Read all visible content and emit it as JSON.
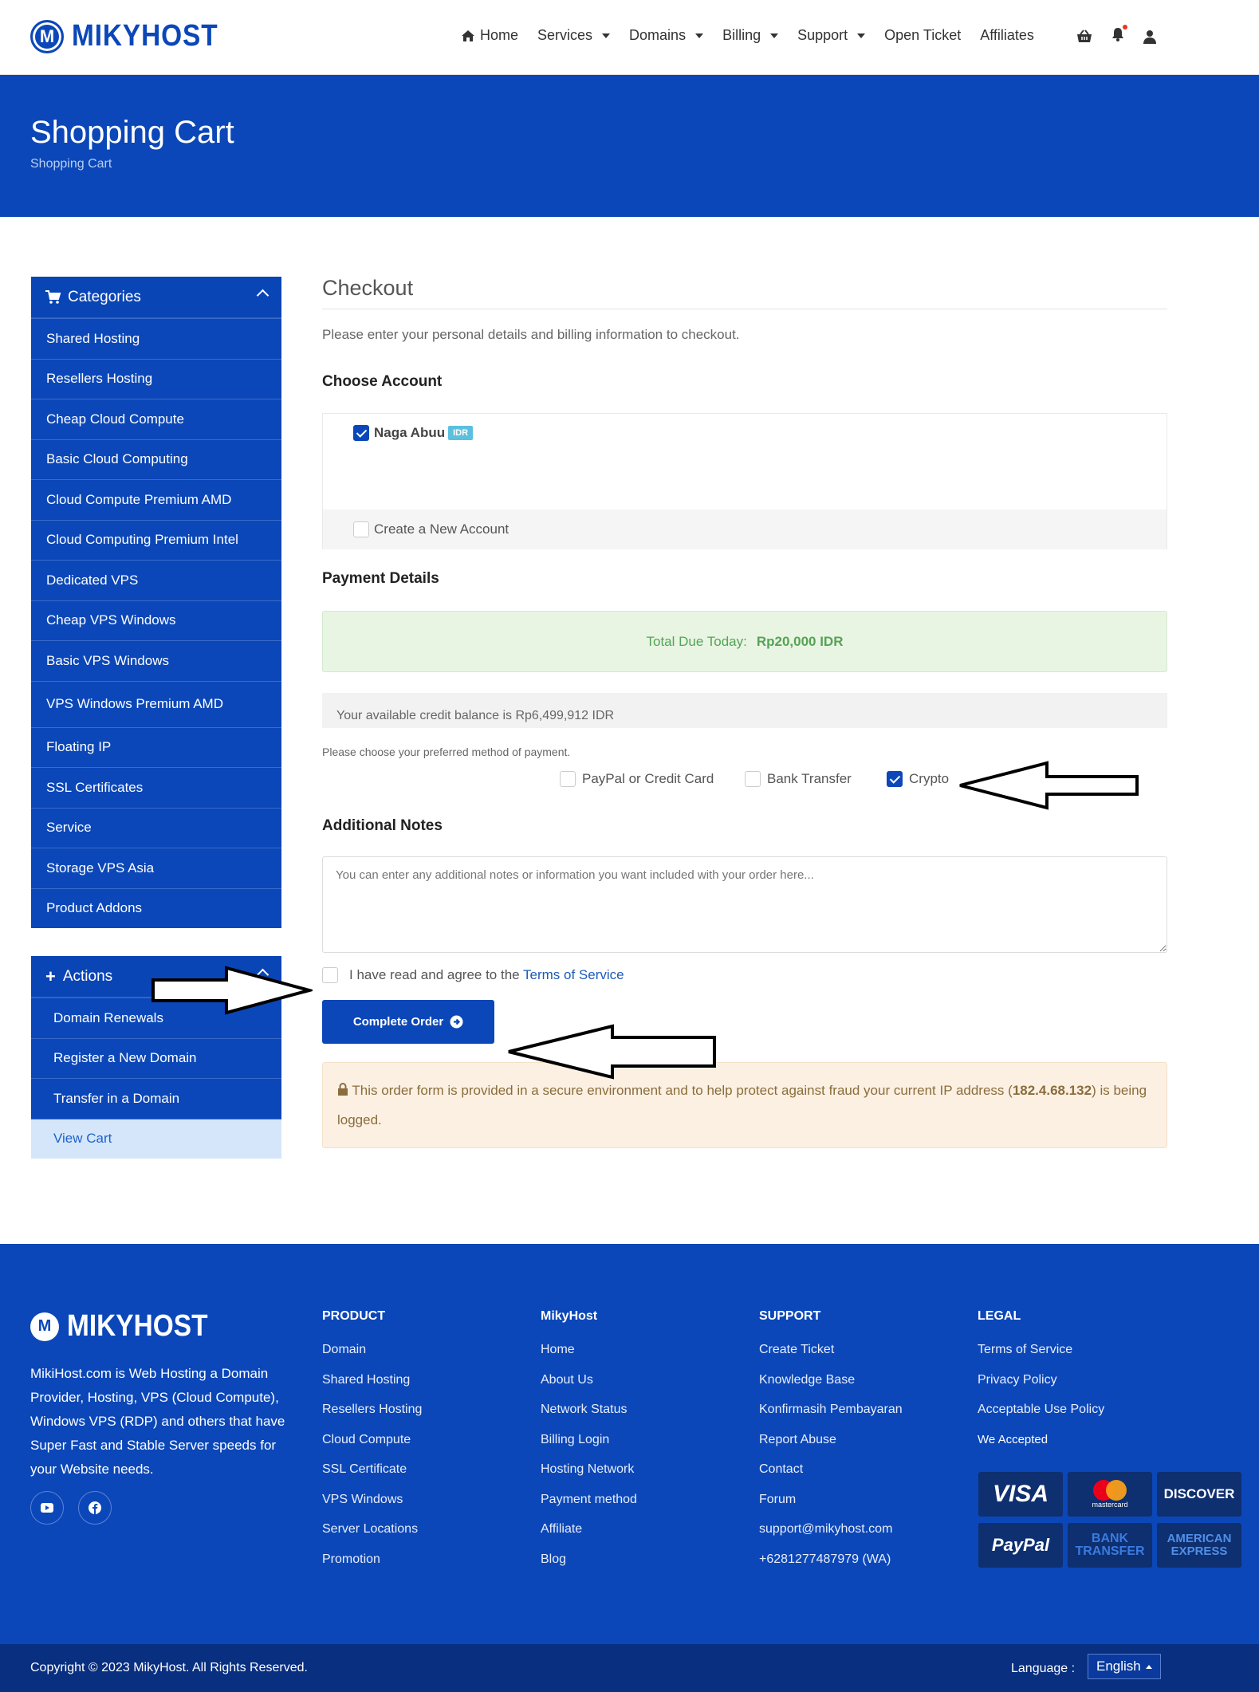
{
  "brand": {
    "name": "MIKYHOST"
  },
  "nav": {
    "home": "Home",
    "services": "Services",
    "domains": "Domains",
    "billing": "Billing",
    "support": "Support",
    "open_ticket": "Open Ticket",
    "affiliates": "Affiliates"
  },
  "banner": {
    "title": "Shopping Cart",
    "breadcrumb": "Shopping Cart"
  },
  "categories": {
    "title": "Categories",
    "items": [
      "Shared Hosting",
      "Resellers Hosting",
      "Cheap Cloud Compute",
      "Basic Cloud Computing",
      "Cloud Compute Premium AMD",
      "Cloud Computing Premium Intel",
      "Dedicated VPS",
      "Cheap VPS Windows",
      "Basic VPS Windows",
      "VPS Windows Premium AMD",
      "Floating IP",
      "SSL Certificates",
      "Service",
      "Storage VPS Asia",
      "Product Addons"
    ]
  },
  "actions": {
    "title": "Actions",
    "items": [
      "Domain Renewals",
      "Register a New Domain",
      "Transfer in a Domain",
      "View Cart"
    ]
  },
  "checkout": {
    "title": "Checkout",
    "intro": "Please enter your personal details and billing information to checkout.",
    "choose_account": "Choose Account",
    "account_name": "Naga Abuu",
    "account_badge": "IDR",
    "new_account": "Create a New Account",
    "payment_details": "Payment Details",
    "total_label": "Total Due Today:",
    "total_value": "Rp20,000 IDR",
    "credit_note": "Your available credit balance is Rp6,499,912 IDR",
    "payment_prompt": "Please choose your preferred method of payment.",
    "methods": [
      "PayPal or Credit Card",
      "Bank Transfer",
      "Crypto"
    ],
    "additional_notes": "Additional Notes",
    "notes_placeholder": "You can enter any additional notes or information you want included with your order here...",
    "tos_prefix": "I have read and agree to the",
    "tos_link": "Terms of Service",
    "complete_button": "Complete Order",
    "secure_text_1": "This order form is provided in a secure environment and to help protect against fraud your current IP address (",
    "ip": "182.4.68.132",
    "secure_text_2": ") is being logged."
  },
  "footer": {
    "description": "MikiHost.com is Web Hosting a Domain Provider, Hosting, VPS (Cloud Compute), Windows VPS (RDP) and others that have Super Fast and Stable Server speeds for your Website needs.",
    "columns": [
      {
        "title": "PRODUCT",
        "links": [
          "Domain",
          "Shared Hosting",
          "Resellers Hosting",
          "Cloud Compute",
          "SSL Certificate",
          "VPS Windows",
          "Server Locations",
          "Promotion"
        ]
      },
      {
        "title": "MikyHost",
        "links": [
          "Home",
          "About Us",
          "Network Status",
          "Billing Login",
          "Hosting Network",
          "Payment method",
          "Affiliate",
          "Blog"
        ]
      },
      {
        "title": "SUPPORT",
        "links": [
          "Create Ticket",
          "Knowledge Base",
          "Konfirmasih Pembayaran",
          "Report Abuse",
          "Contact",
          "Forum",
          "support@mikyhost.com",
          "+6281277487979 (WA)"
        ]
      },
      {
        "title": "LEGAL",
        "links": [
          "Terms of Service",
          "Privacy Policy",
          "Acceptable Use Policy"
        ]
      }
    ],
    "we_accepted": "We Accepted",
    "payment_logos": [
      "VISA",
      "mastercard",
      "DISCOVER",
      "PayPal",
      "BANK TRANSFER",
      "AMERICAN EXPRESS"
    ],
    "copyright": "Copyright © 2023 MikyHost. All Rights Reserved.",
    "language_label": "Language :",
    "language_value": "English"
  },
  "colors": {
    "primary": "#0b47b8",
    "dark": "#082f80",
    "success_bg": "#e8f5e3",
    "warning_bg": "#fcf0e3"
  }
}
